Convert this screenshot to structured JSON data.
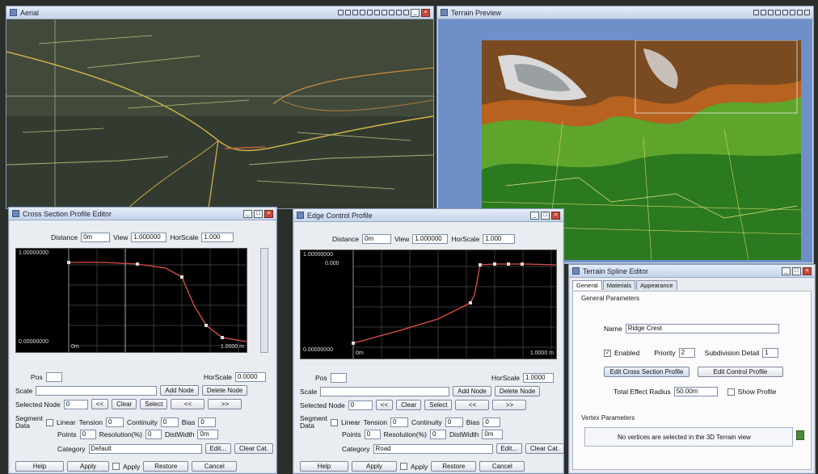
{
  "aerial": {
    "title": "Aerial"
  },
  "terrain": {
    "title": "Terrain Preview"
  },
  "xsect": {
    "title": "Cross Section Profile Editor",
    "distance_label": "Distance",
    "distance_value": "0m",
    "view_label": "View",
    "view_value": "1.000000",
    "hscale_label": "HorScale",
    "hscale_value": "1.000",
    "plot_top_left": "1.00000000",
    "plot_bottom_left": "0.00000000",
    "plot_origin": "0m",
    "plot_bottom_right": "1.0000 m",
    "pos_label": "Pos",
    "hscale2_label": "HorScale",
    "hscale2_value": "0.0000",
    "scale_label": "Scale",
    "add_node_btn": "Add Node",
    "delete_node_btn": "Delete Node",
    "selected_node_label": "Selected Node",
    "selected_node_value": "0",
    "btn_a": "<<",
    "btn_b": "Clear",
    "btn_c": "Select",
    "btn_d": "<<",
    "btn_e": ">>",
    "segment_label": "Segment\nData",
    "linear_label": "Linear",
    "tension_label": "Tension",
    "tension_value": "0",
    "continuity_label": "Continuity",
    "continuity_value": "0",
    "bias_label": "Bias",
    "bias_value": "0",
    "points_label": "Points",
    "points_value": "0",
    "resolution_label": "Resolution(%)",
    "resolution_value": "0",
    "dist_label": "DistWidth",
    "dist_value": "0m",
    "category_label": "Category",
    "category_value": "Default",
    "edit_btn": "Edit...",
    "clear_btn": "Clear Cat.",
    "help_btn": "Help",
    "apply_btn": "Apply",
    "apply_chk": "Apply",
    "restore_btn": "Restore",
    "cancel_btn": "Cancel"
  },
  "ctrl": {
    "title": "Edge Control Profile",
    "distance_label": "Distance",
    "distance_value": "0m",
    "view_label": "View",
    "view_value": "1.000000",
    "hscale_label": "HorScale",
    "hscale_value": "1.000",
    "plot_top_left": "1.00000000",
    "plot_top_value": "0.000",
    "plot_bottom_left": "0.00000000",
    "plot_origin": "0m",
    "plot_bottom_right": "1.0000 m",
    "pos_label": "Pos",
    "hscale2_label": "HorScale",
    "hscale2_value": "1.0000",
    "scale_label": "Scale",
    "add_node_btn": "Add Node",
    "delete_node_btn": "Delete Node",
    "selected_node_label": "Selected Node",
    "selected_node_value": "0",
    "btn_a": "<<",
    "btn_b": "Clear",
    "btn_c": "Select",
    "btn_d": "<<",
    "btn_e": ">>",
    "segment_label": "Segment\nData",
    "linear_label": "Linear",
    "tension_label": "Tension",
    "tension_value": "0",
    "continuity_label": "Continuity",
    "continuity_value": "0",
    "bias_label": "Bias",
    "bias_value": "0",
    "points_label": "Points",
    "points_value": "0",
    "resolution_label": "Resolution(%)",
    "resolution_value": "0",
    "dist_label": "DistWidth",
    "dist_value": "0m",
    "category_label": "Category",
    "category_value": "Road",
    "edit_btn": "Edit...",
    "clear_btn": "Clear Cat.",
    "help_btn": "Help",
    "apply_btn": "Apply",
    "apply_chk": "Apply",
    "restore_btn": "Restore",
    "cancel_btn": "Cancel"
  },
  "spline": {
    "title": "Terrain Spline Editor",
    "tabs": [
      "General",
      "Materials",
      "Appearance"
    ],
    "section_general": "General Parameters",
    "name_label": "Name",
    "name_value": "Ridge Crest",
    "enabled_label": "Enabled",
    "priority_label": "Priority",
    "priority_value": "2",
    "detail_label": "Subdivision Detail",
    "detail_value": "1",
    "edit_profile_btn": "Edit Cross Section Profile",
    "edit_ctrl_btn": "Edit Control Profile",
    "total_label": "Total Effect Radius",
    "total_value": "50.00m",
    "show_label": "Show Profile",
    "section_vertex": "Vertex Parameters",
    "vertex_hint": "No vertices are selected in the 3D Terrain view"
  },
  "colors": {
    "title_bar": "#c5d4ea",
    "plot_bg": "#000000",
    "curve": "#e0524a",
    "accent": "#6f8fc9"
  }
}
